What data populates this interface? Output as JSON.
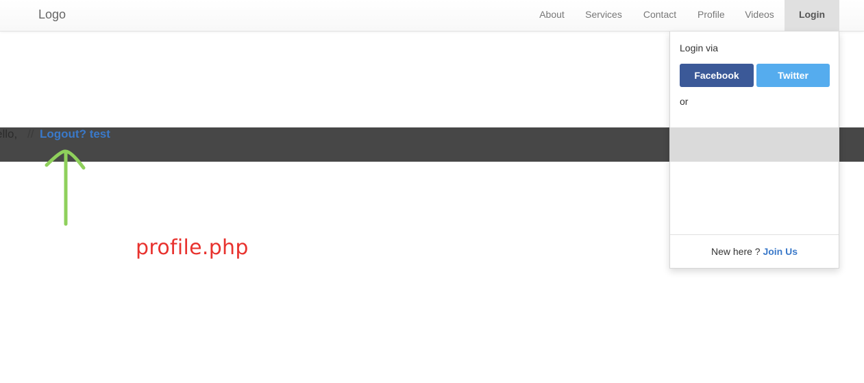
{
  "navbar": {
    "brand": "Logo",
    "items": [
      {
        "label": "About"
      },
      {
        "label": "Services"
      },
      {
        "label": "Contact"
      },
      {
        "label": "Profile"
      },
      {
        "label": "Videos"
      }
    ],
    "login_label": "Login"
  },
  "banner": {
    "hello_prefix": "ello,",
    "separator": "//",
    "logout_link": "Logout? test"
  },
  "annotation": {
    "label": "profile.php",
    "arrow_color": "#8fd05c",
    "label_color": "#e8322e"
  },
  "dropdown": {
    "login_via": "Login via",
    "facebook_label": "Facebook",
    "twitter_label": "Twitter",
    "or_text": "or",
    "footer_text": "New here ?",
    "join_link": "Join Us"
  },
  "colors": {
    "facebook": "#3b5998",
    "twitter": "#55acee",
    "link": "#3a79c9",
    "band": "#474747"
  }
}
